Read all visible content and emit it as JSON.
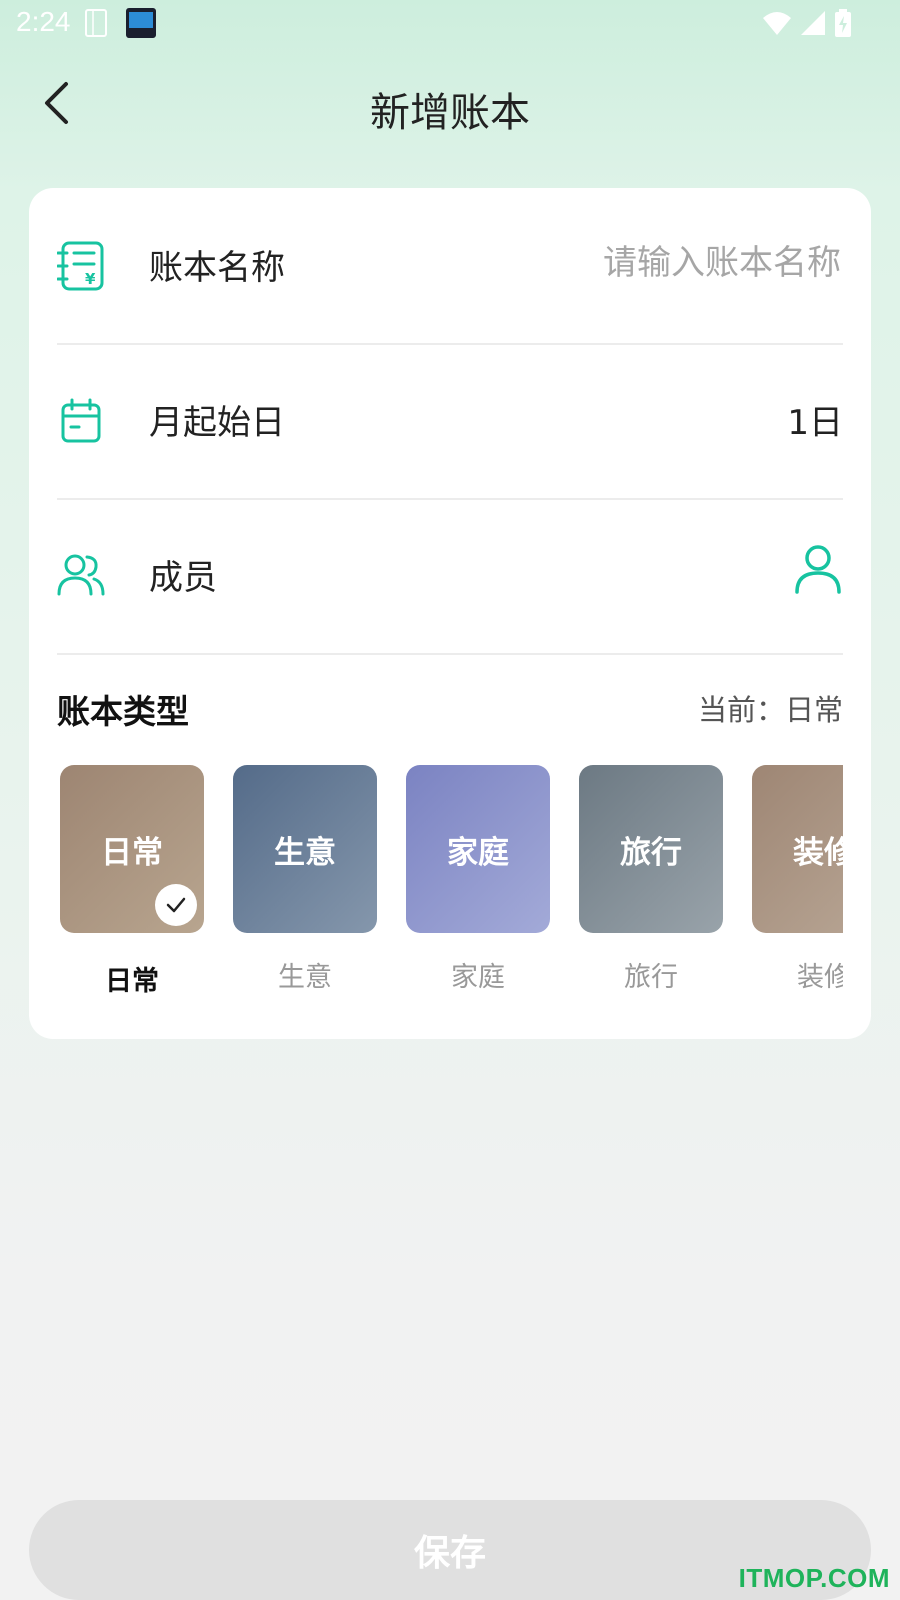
{
  "status_bar": {
    "time": "2:24",
    "icons": [
      "sim-card-icon",
      "app-notification-icon",
      "wifi-icon",
      "signal-icon",
      "battery-charging-icon"
    ]
  },
  "header": {
    "title": "新增账本",
    "back_icon": "chevron-left-icon"
  },
  "form": {
    "name": {
      "icon": "ledger-list-icon",
      "label": "账本名称",
      "placeholder": "请输入账本名称",
      "value": ""
    },
    "start_day": {
      "icon": "calendar-icon",
      "label": "月起始日",
      "value": "1日"
    },
    "members": {
      "icon": "group-icon",
      "label": "成员",
      "add_icon": "person-icon"
    }
  },
  "book_type": {
    "title": "账本类型",
    "current_text": "当前：日常",
    "items": [
      {
        "name": "日常",
        "caption": "日常",
        "selected": true
      },
      {
        "name": "生意",
        "caption": "生意",
        "selected": false
      },
      {
        "name": "家庭",
        "caption": "家庭",
        "selected": false
      },
      {
        "name": "旅行",
        "caption": "旅行",
        "selected": false
      },
      {
        "name": "装修",
        "caption": "装修",
        "selected": false
      }
    ]
  },
  "save_button": {
    "label": "保存"
  },
  "watermark": "ITMOP.COM",
  "colors": {
    "accent": "#17c3a0",
    "tile_daily": "#a58c78",
    "tile_business": "#5f7896",
    "tile_family": "#8a92cc",
    "tile_travel": "#79868f",
    "tile_decor": "#a88f7e",
    "save_disabled": "#e0e0e0",
    "watermark": "#1fb35b"
  }
}
